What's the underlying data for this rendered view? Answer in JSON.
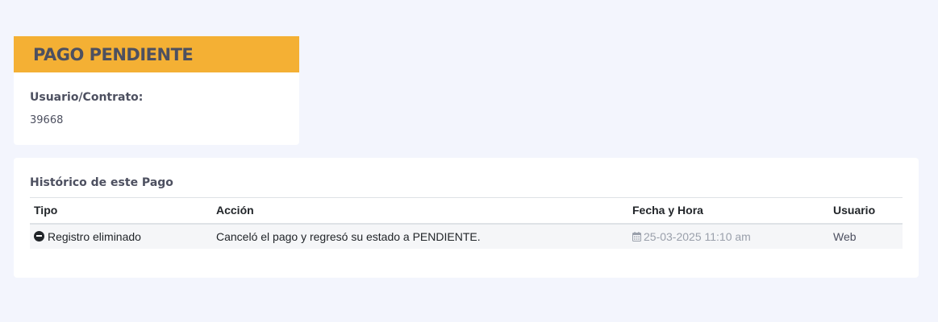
{
  "status_card": {
    "title": "PAGO PENDIENTE",
    "field_label": "Usuario/Contrato:",
    "field_value": "39668"
  },
  "history": {
    "title": "Histórico de este Pago",
    "columns": [
      "Tipo",
      "Acción",
      "Fecha y Hora",
      "Usuario"
    ],
    "rows": [
      {
        "tipo": "Registro eliminado",
        "tipo_icon": "minus-circle-icon",
        "accion": "Canceló el pago y regresó su estado a PENDIENTE.",
        "fecha": "25-03-2025 11:10 am",
        "fecha_icon": "calendar-icon",
        "usuario": "Web"
      }
    ]
  },
  "colors": {
    "status_accent": "#f4b034",
    "background": "#f3f5fd",
    "text_primary": "#4d5060",
    "date_text": "#9aa0ab"
  }
}
